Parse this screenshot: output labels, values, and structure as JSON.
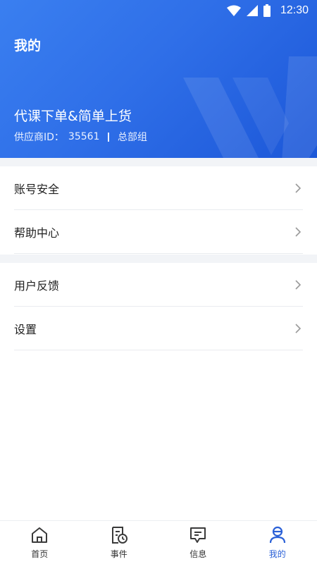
{
  "status_bar": {
    "time": "12:30"
  },
  "header": {
    "title": "我的",
    "org_name": "代课下单&简单上货",
    "supplier_label": "供应商ID：",
    "supplier_id": "35561",
    "group": "总部组"
  },
  "menu_group_1": [
    {
      "label": "账号安全"
    },
    {
      "label": "帮助中心"
    }
  ],
  "menu_group_2": [
    {
      "label": "用户反馈"
    },
    {
      "label": "设置"
    }
  ],
  "tabbar": {
    "items": [
      {
        "label": "首页",
        "icon": "home-icon"
      },
      {
        "label": "事件",
        "icon": "event-clock-icon"
      },
      {
        "label": "信息",
        "icon": "message-icon"
      },
      {
        "label": "我的",
        "icon": "profile-icon",
        "active": true
      }
    ],
    "active_color": "#2a60d7"
  },
  "colors": {
    "header_gradient_start": "#3a7ff0",
    "header_gradient_end": "#1c57d8",
    "accent": "#2a60d7",
    "gap_bg": "#f2f4f7"
  }
}
